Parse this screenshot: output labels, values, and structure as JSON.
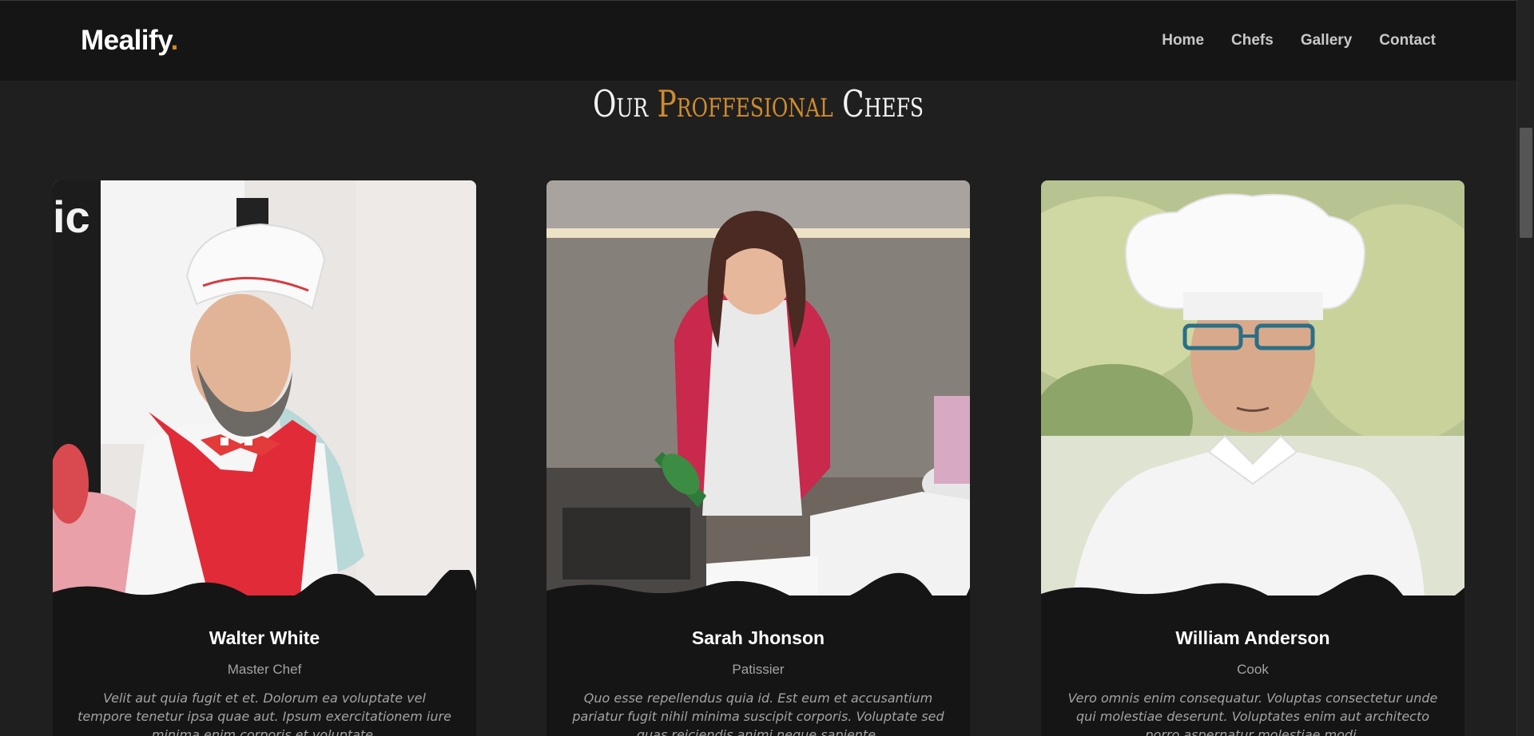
{
  "brand": {
    "name": "Mealify",
    "dot": ".",
    "accent_color": "#cf8b2f"
  },
  "nav": {
    "items": [
      {
        "label": "Home"
      },
      {
        "label": "Chefs"
      },
      {
        "label": "Gallery"
      },
      {
        "label": "Contact"
      }
    ]
  },
  "section": {
    "title_prefix": "Our ",
    "title_accent": "Proffesional",
    "title_suffix": " Chefs"
  },
  "chefs": [
    {
      "name": "Walter White",
      "role": "Master Chef",
      "description": "Velit aut quia fugit et et. Dolorum ea voluptate vel tempore tenetur ipsa quae aut. Ipsum exercitationem iure minima enim corporis et voluptate."
    },
    {
      "name": "Sarah Jhonson",
      "role": "Patissier",
      "description": "Quo esse repellendus quia id. Est eum et accusantium pariatur fugit nihil minima suscipit corporis. Voluptate sed quas reiciendis animi neque sapiente."
    },
    {
      "name": "William Anderson",
      "role": "Cook",
      "description": "Vero omnis enim consequatur. Voluptas consectetur unde qui molestiae deserunt. Voluptates enim aut architecto porro aspernatur molestiae modi."
    }
  ]
}
